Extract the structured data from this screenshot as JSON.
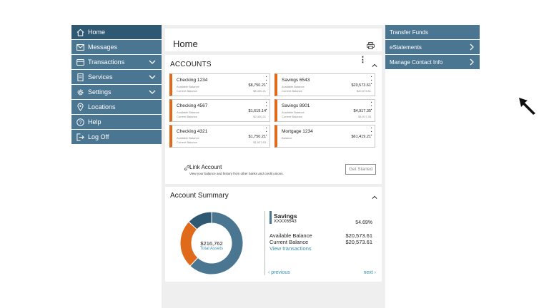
{
  "sidebar": {
    "items": [
      {
        "label": "Home",
        "icon": "home-icon"
      },
      {
        "label": "Messages",
        "icon": "mail-icon"
      },
      {
        "label": "Transactions",
        "icon": "card-icon"
      },
      {
        "label": "Services",
        "icon": "document-icon"
      },
      {
        "label": "Settings",
        "icon": "gear-icon"
      },
      {
        "label": "Locations",
        "icon": "location-pin-icon"
      },
      {
        "label": "Help",
        "icon": "help-icon"
      },
      {
        "label": "Log Off",
        "icon": "logout-icon"
      }
    ]
  },
  "header": {
    "title": "Home"
  },
  "accounts": {
    "heading": "ACCOUNTS",
    "list": [
      {
        "name": "Checking 1234",
        "label1": "Available Balance",
        "value1": "$8,750.21",
        "label2": "Current Balance",
        "value2": "$8,430.21"
      },
      {
        "name": "Savings 6543",
        "label1": "Available Balance",
        "value1": "$20,573.61",
        "label2": "Current Balance",
        "value2": "$20,573.61"
      },
      {
        "name": "Checking 4567",
        "label1": "Available Balance",
        "value1": "$1,619.14",
        "label2": "Current Balance",
        "value2": "$2,430.21"
      },
      {
        "name": "Savings 8901",
        "label1": "Available Balance",
        "value1": "$4,917.35",
        "label2": "Current Balance",
        "value2": "$4,917.35"
      },
      {
        "name": "Checking 4321",
        "label1": "Available Balance",
        "value1": "$1,750.21",
        "label2": "Current Balance",
        "value2": "$1,527.63"
      },
      {
        "name": "Mortgage 1234",
        "label1": "Balance",
        "value1": "$61,419.21",
        "label2": "",
        "value2": ""
      }
    ]
  },
  "link_account": {
    "title": "Link Account",
    "description": "View your balance and history from other banks and credit unions.",
    "button": "Get Started"
  },
  "summary": {
    "heading": "Account Summary",
    "total": "$216,762",
    "total_label": "Total Assets",
    "account_name": "Savings",
    "account_number": "XXXX6543",
    "percent": "54.69%",
    "available_label": "Available Balance",
    "available_value": "$20,573.61",
    "current_label": "Current Balance",
    "current_value": "$20,573.61",
    "view_link": "View transactions",
    "previous": "previous",
    "next": "next",
    "donut_fractions": [
      0.62,
      0.25,
      0.13
    ],
    "donut_colors": [
      "#4a7691",
      "#e06a1c",
      "#2f5873"
    ]
  },
  "right_panel": {
    "items": [
      {
        "label": "Transfer Funds"
      },
      {
        "label": "eStatements"
      },
      {
        "label": "Manage Contact Info"
      }
    ]
  },
  "colors": {
    "nav": "#4a7691",
    "nav_active": "#2f5873",
    "accent": "#e06a1c",
    "link": "#3a8fb0"
  }
}
